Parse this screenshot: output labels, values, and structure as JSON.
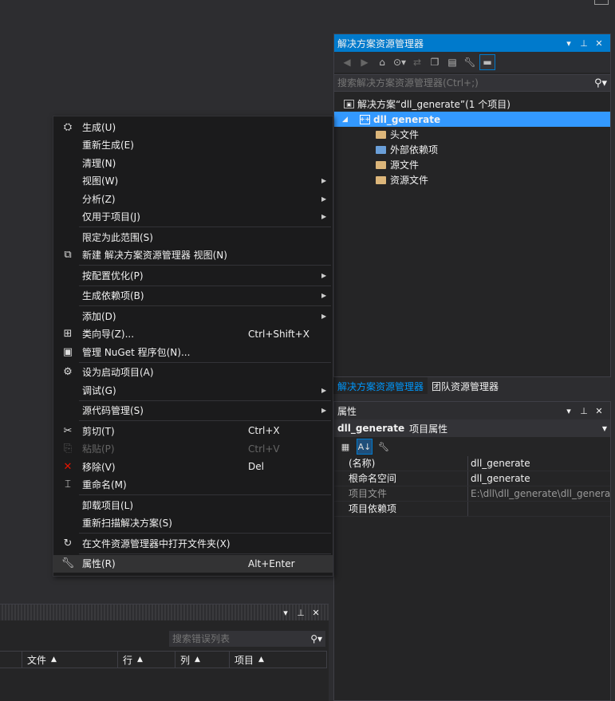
{
  "solution_explorer": {
    "title": "解决方案资源管理器",
    "search_placeholder": "搜索解决方案资源管理器(Ctrl+;)",
    "tree": {
      "solution": "解决方案“dll_generate”(1 个项目)",
      "project": "dll_generate",
      "children": [
        "头文件",
        "外部依赖项",
        "源文件",
        "资源文件"
      ]
    },
    "tabs": [
      "解决方案资源管理器",
      "团队资源管理器"
    ]
  },
  "properties": {
    "title": "属性",
    "object_name": "dll_generate",
    "object_type": "项目属性",
    "rows": [
      {
        "key": "(名称)",
        "value": "dll_generate"
      },
      {
        "key": "根命名空间",
        "value": "dll_generate"
      },
      {
        "key": "项目文件",
        "value": "E:\\dll\\dll_generate\\dll_generat"
      },
      {
        "key": "项目依赖项",
        "value": ""
      }
    ]
  },
  "error_list": {
    "search_placeholder": "搜索错误列表",
    "columns": [
      "文件",
      "行",
      "列",
      "项目"
    ]
  },
  "context_menu": {
    "groups": [
      [
        {
          "label": "生成(U)",
          "icon": "build-icon"
        },
        {
          "label": "重新生成(E)"
        },
        {
          "label": "清理(N)"
        },
        {
          "label": "视图(W)",
          "submenu": true
        },
        {
          "label": "分析(Z)",
          "submenu": true
        },
        {
          "label": "仅用于项目(J)",
          "submenu": true
        }
      ],
      [
        {
          "label": "限定为此范围(S)"
        },
        {
          "label": "新建 解决方案资源管理器 视图(N)",
          "icon": "new-view-icon"
        }
      ],
      [
        {
          "label": "按配置优化(P)",
          "submenu": true
        }
      ],
      [
        {
          "label": "生成依赖项(B)",
          "submenu": true
        }
      ],
      [
        {
          "label": "添加(D)",
          "submenu": true
        },
        {
          "label": "类向导(Z)...",
          "shortcut": "Ctrl+Shift+X",
          "icon": "class-wizard-icon"
        },
        {
          "label": "管理 NuGet 程序包(N)...",
          "icon": "nuget-icon"
        }
      ],
      [
        {
          "label": "设为启动项目(A)",
          "icon": "gear-icon"
        },
        {
          "label": "调试(G)",
          "submenu": true
        }
      ],
      [
        {
          "label": "源代码管理(S)",
          "submenu": true
        }
      ],
      [
        {
          "label": "剪切(T)",
          "shortcut": "Ctrl+X",
          "icon": "scissors-icon"
        },
        {
          "label": "粘贴(P)",
          "shortcut": "Ctrl+V",
          "icon": "paste-icon",
          "disabled": true
        },
        {
          "label": "移除(V)",
          "shortcut": "Del",
          "icon": "remove-x-icon"
        },
        {
          "label": "重命名(M)",
          "icon": "rename-icon"
        }
      ],
      [
        {
          "label": "卸载项目(L)"
        },
        {
          "label": "重新扫描解决方案(S)"
        }
      ],
      [
        {
          "label": "在文件资源管理器中打开文件夹(X)",
          "icon": "open-folder-arrow-icon"
        }
      ],
      [
        {
          "label": "属性(R)",
          "shortcut": "Alt+Enter",
          "icon": "wrench-icon",
          "highlight": true
        }
      ]
    ]
  }
}
